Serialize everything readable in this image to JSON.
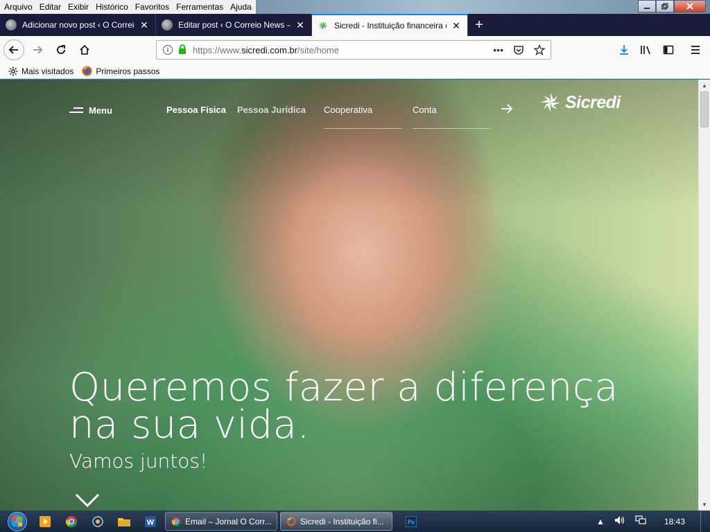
{
  "menubar": {
    "items": [
      "Arquivo",
      "Editar",
      "Exibir",
      "Histórico",
      "Favoritos",
      "Ferramentas",
      "Ajuda"
    ]
  },
  "tabs": [
    {
      "title": "Adicionar novo post ‹ O Correio",
      "active": false
    },
    {
      "title": "Editar post ‹ O Correio News —",
      "active": false
    },
    {
      "title": "Sicredi - Instituição financeira c",
      "active": true
    }
  ],
  "navbar": {
    "url_prefix": "https://www.",
    "url_host": "sicredi.com.br",
    "url_path": "/site/home",
    "page_actions": "•••"
  },
  "bookmarks": [
    {
      "label": "Mais visitados",
      "icon": "gear-icon"
    },
    {
      "label": "Primeiros passos",
      "icon": "firefox-icon"
    }
  ],
  "site": {
    "menu_label": "Menu",
    "nav": [
      "Pessoa Física",
      "Pessoa Jurídica",
      "Cooperativa",
      "Conta"
    ],
    "logo_text": "Sicredi",
    "headline_line1": "Queremos fazer a diferença",
    "headline_line2": "na sua vida.",
    "subhead": "Vamos juntos!"
  },
  "taskbar": {
    "tasks": [
      {
        "label": "Email – Jornal O Corr...",
        "icon": "chrome-icon",
        "active": false
      },
      {
        "label": "Sicredi - Instituição fi...",
        "icon": "firefox-icon",
        "active": true
      }
    ],
    "clock": "18:43"
  },
  "colors": {
    "accent": "#0a84ff",
    "tab_bar": "#1a1a3a",
    "secure_lock": "#12bc00",
    "download_icon": "#0a84ff"
  }
}
